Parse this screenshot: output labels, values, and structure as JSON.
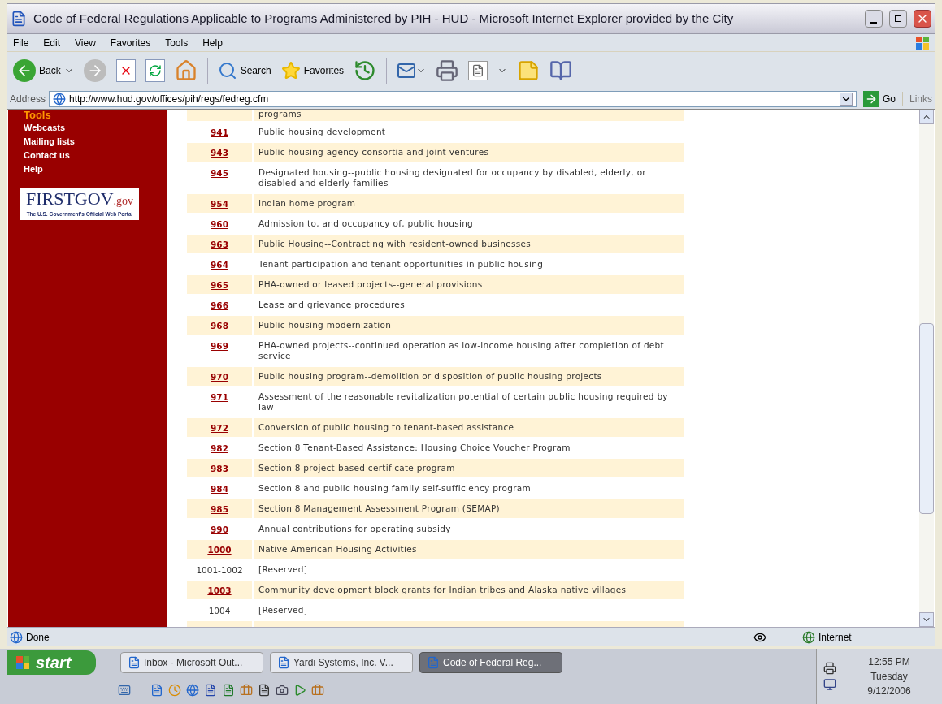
{
  "window": {
    "title": "Code of Federal Regulations Applicable to Programs Administered by PIH - HUD - Microsoft Internet Explorer provided by the City"
  },
  "menu": [
    "File",
    "Edit",
    "View",
    "Favorites",
    "Tools",
    "Help"
  ],
  "toolbar": {
    "back": "Back",
    "search": "Search",
    "favorites": "Favorites"
  },
  "address": {
    "label": "Address",
    "url": "http://www.hud.gov/offices/pih/regs/fedreg.cfm",
    "go": "Go",
    "links": "Links"
  },
  "sidebar": {
    "section": "Tools",
    "items": [
      "Webcasts",
      "Mailing lists",
      "Contact us",
      "Help"
    ],
    "logo": {
      "name": "FIRSTGOV",
      "domain": ".gov",
      "tagline": "The U.S. Government's Official Web Portal"
    }
  },
  "table": {
    "top_fragment": "programs",
    "rows": [
      {
        "part": "941",
        "kind": "link",
        "title": "Public housing development"
      },
      {
        "part": "943",
        "kind": "link",
        "title": "Public housing agency consortia and joint ventures"
      },
      {
        "part": "945",
        "kind": "link",
        "title": "Designated housing--public housing designated for occupancy by disabled, elderly, or disabled and elderly families"
      },
      {
        "part": "954",
        "kind": "link",
        "title": "Indian home program"
      },
      {
        "part": "960",
        "kind": "link",
        "title": "Admission to, and occupancy of, public housing"
      },
      {
        "part": "963",
        "kind": "link",
        "title": "Public Housing--Contracting with resident-owned businesses"
      },
      {
        "part": "964",
        "kind": "link",
        "title": "Tenant participation and tenant opportunities in public housing"
      },
      {
        "part": "965",
        "kind": "link",
        "title": "PHA-owned or leased projects--general provisions"
      },
      {
        "part": "966",
        "kind": "link",
        "title": "Lease and grievance procedures"
      },
      {
        "part": "968",
        "kind": "link",
        "title": "Public housing modernization"
      },
      {
        "part": "969",
        "kind": "link",
        "title": "PHA-owned projects--continued operation as low-income housing after completion of debt service"
      },
      {
        "part": "970",
        "kind": "link",
        "title": "Public housing program--demolition or disposition of public housing projects"
      },
      {
        "part": "971",
        "kind": "link",
        "title": "Assessment of the reasonable revitalization potential of certain public housing required by law"
      },
      {
        "part": "972",
        "kind": "link",
        "title": "Conversion of public housing to tenant-based assistance"
      },
      {
        "part": "982",
        "kind": "link",
        "title": "Section 8 Tenant-Based Assistance: Housing Choice Voucher Program"
      },
      {
        "part": "983",
        "kind": "link",
        "title": "Section 8 project-based certificate program"
      },
      {
        "part": "984",
        "kind": "link",
        "title": "Section 8 and public housing family self-sufficiency program"
      },
      {
        "part": "985",
        "kind": "link",
        "title": "Section 8 Management Assessment Program (SEMAP)"
      },
      {
        "part": "990",
        "kind": "link",
        "title": "Annual contributions for operating subsidy"
      },
      {
        "part": "1000",
        "kind": "link",
        "title": "Native American Housing Activities"
      },
      {
        "part": "1001-1002",
        "kind": "plain",
        "title": "[Reserved]"
      },
      {
        "part": "1003",
        "kind": "link",
        "title": "Community development block grants for Indian tribes and Alaska native villages"
      },
      {
        "part": "1004",
        "kind": "plain",
        "title": "[Reserved]"
      }
    ]
  },
  "status_bar": {
    "text": "Done",
    "zone": "Internet"
  },
  "taskbar": {
    "start": "start",
    "tasks": [
      {
        "label": "Inbox - Microsoft Out...",
        "selected": false
      },
      {
        "label": "Yardi Systems, Inc. V...",
        "selected": false
      },
      {
        "label": "Code of Federal Reg...",
        "selected": true
      }
    ],
    "clock": {
      "time": "12:55 PM",
      "day": "Tuesday",
      "date": "9/12/2006"
    }
  }
}
